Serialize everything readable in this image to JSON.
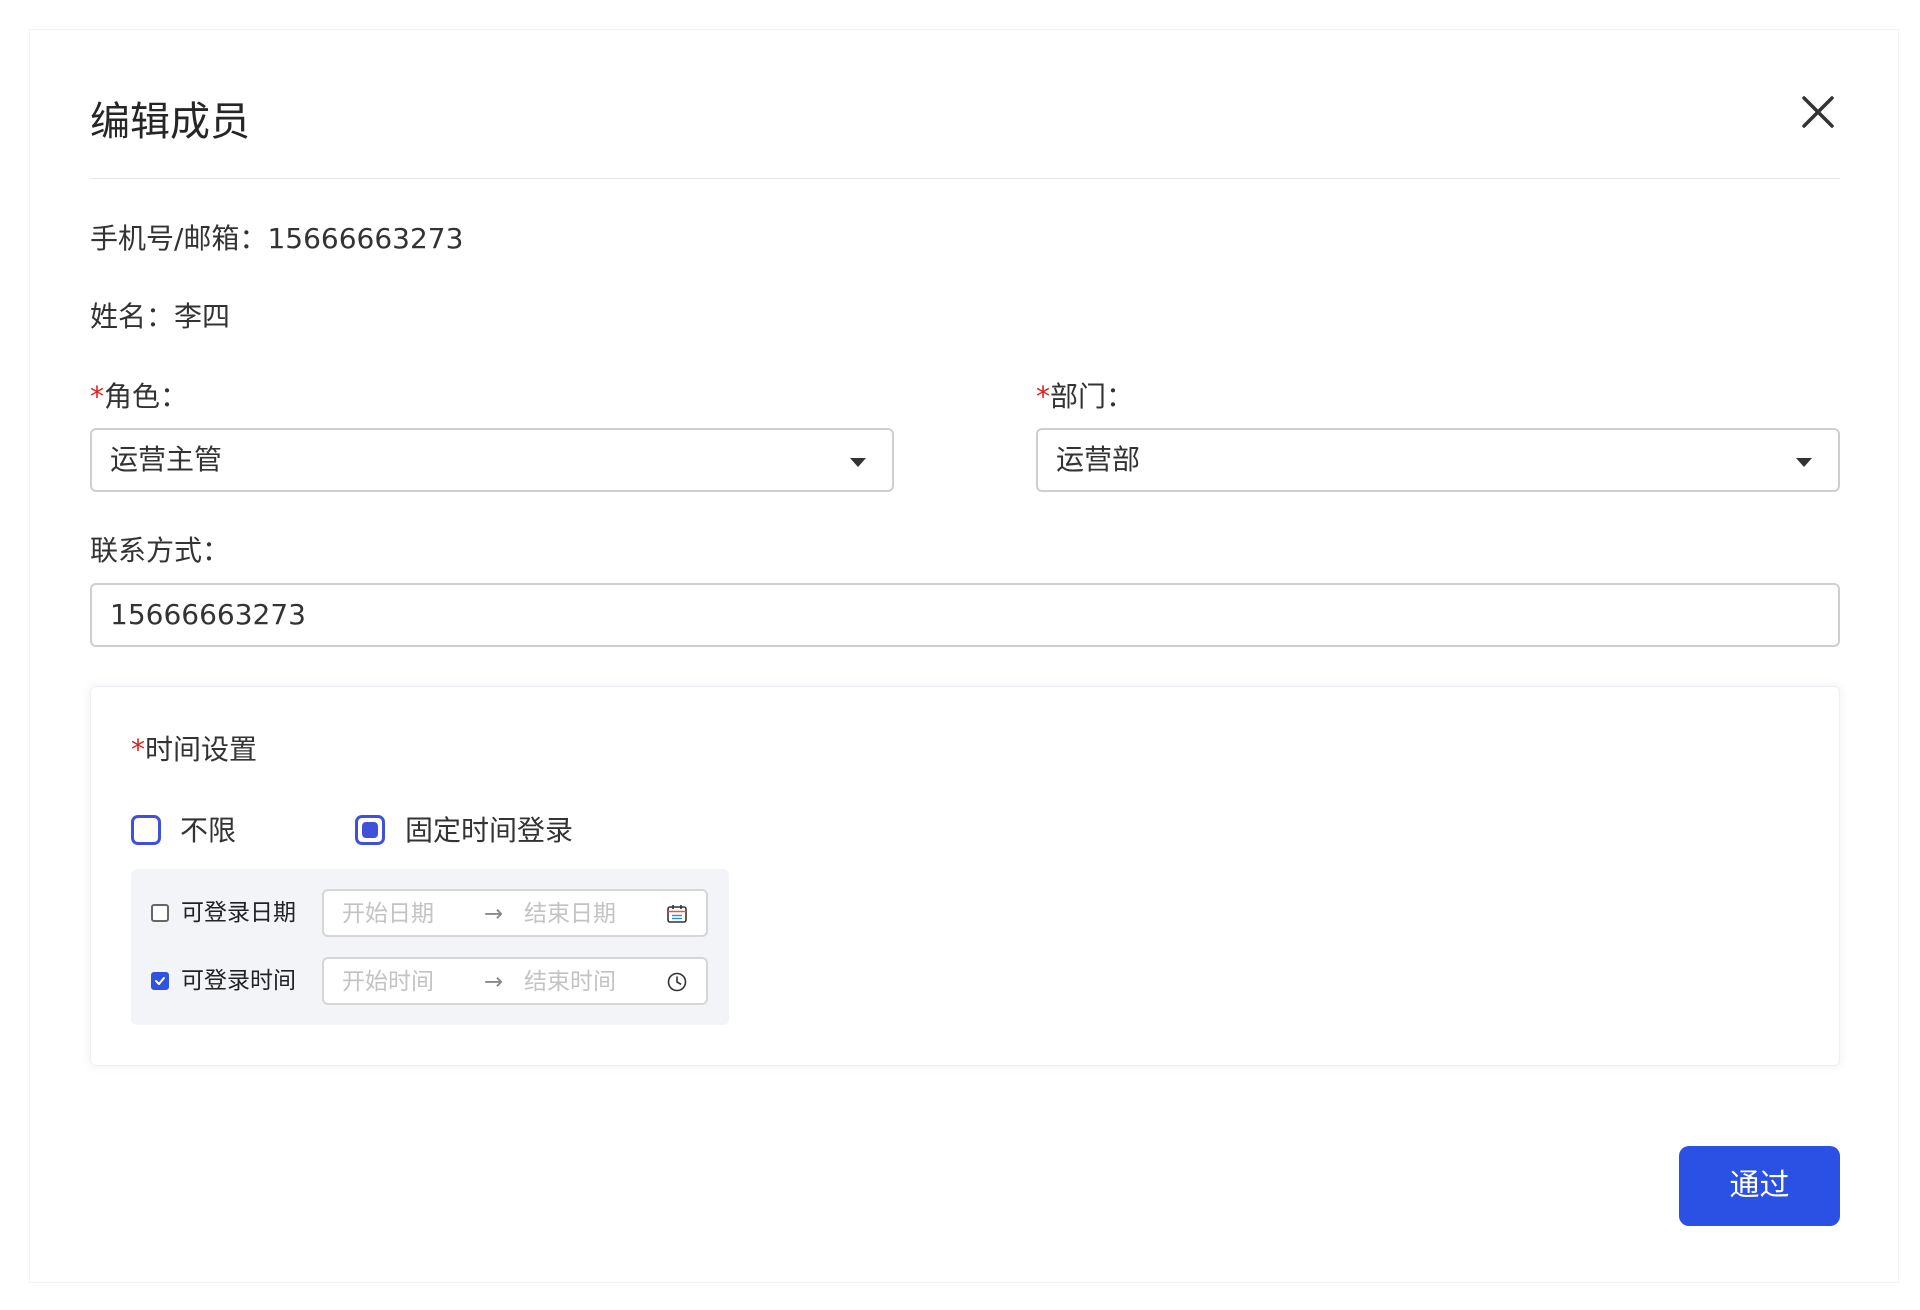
{
  "dialog": {
    "title": "编辑成员",
    "phone_email": {
      "label": "手机号/邮箱：",
      "value": "15666663273"
    },
    "name": {
      "label": "姓名：",
      "value": "李四"
    },
    "role": {
      "required": "*",
      "label": "角色：",
      "value": "运营主管"
    },
    "department": {
      "required": "*",
      "label": "部门：",
      "value": "运营部"
    },
    "contact": {
      "label": "联系方式：",
      "value": "15666663273"
    },
    "time_settings": {
      "required": "*",
      "title": "时间设置",
      "options": [
        {
          "label": "不限",
          "selected": false
        },
        {
          "label": "固定时间登录",
          "selected": true
        }
      ],
      "login_date": {
        "label": "可登录日期",
        "checked": false,
        "start_placeholder": "开始日期",
        "separator": "→",
        "end_placeholder": "结束日期",
        "icon": "calendar-icon"
      },
      "login_time": {
        "label": "可登录时间",
        "checked": true,
        "start_placeholder": "开始时间",
        "separator": "→",
        "end_placeholder": "结束时间",
        "icon": "clock-icon"
      }
    },
    "submit_label": "通过",
    "close_icon": "close-icon"
  },
  "colors": {
    "accent": "#2b50e4",
    "required": "#e02020",
    "radio": "#3f51d8"
  }
}
